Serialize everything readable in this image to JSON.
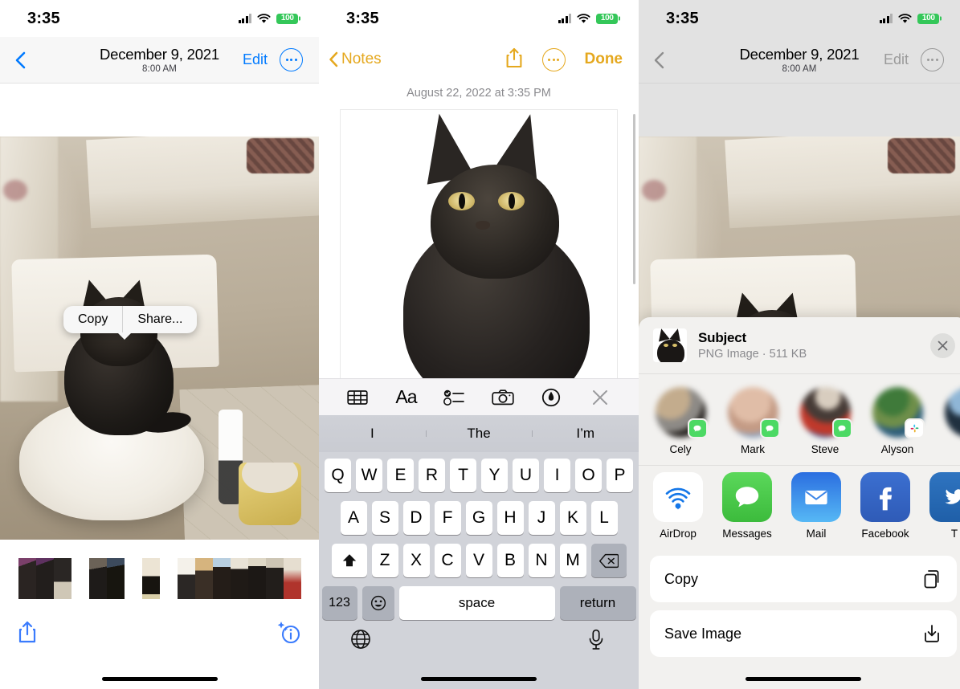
{
  "status_bar": {
    "time": "3:35",
    "battery": "100",
    "wifi_icon": "wifi-icon",
    "cellular_icon": "cellular-icon"
  },
  "panel_photos": {
    "nav": {
      "back_icon": "chevron-left-icon",
      "title": "December 9, 2021",
      "subtitle": "8:00 AM",
      "edit_label": "Edit",
      "more_icon": "ellipsis-circle-icon"
    },
    "context_menu": {
      "copy_label": "Copy",
      "share_label": "Share..."
    },
    "toolbar": {
      "share_icon": "share-icon",
      "info_icon": "info-sparkle-icon"
    }
  },
  "panel_notes": {
    "nav": {
      "back_icon": "chevron-left-icon",
      "back_label": "Notes",
      "share_icon": "share-icon",
      "more_icon": "ellipsis-circle-icon",
      "done_label": "Done",
      "accent_color": "#e5a81e"
    },
    "date_stamp": "August 22, 2022 at 3:35 PM",
    "toolbar": [
      {
        "name": "table-icon",
        "label": ""
      },
      {
        "name": "text-format-icon",
        "label": "Aa"
      },
      {
        "name": "checklist-icon",
        "label": ""
      },
      {
        "name": "camera-icon",
        "label": ""
      },
      {
        "name": "markup-pen-icon",
        "label": ""
      },
      {
        "name": "close-icon",
        "label": ""
      }
    ],
    "keyboard": {
      "suggestions": [
        "I",
        "The",
        "I’m"
      ],
      "row1": [
        "Q",
        "W",
        "E",
        "R",
        "T",
        "Y",
        "U",
        "I",
        "O",
        "P"
      ],
      "row2": [
        "A",
        "S",
        "D",
        "F",
        "G",
        "H",
        "J",
        "K",
        "L"
      ],
      "row3": [
        "Z",
        "X",
        "C",
        "V",
        "B",
        "N",
        "M"
      ],
      "shift_icon": "shift-icon",
      "backspace_icon": "backspace-icon",
      "numbers_label": "123",
      "emoji_icon": "emoji-icon",
      "space_label": "space",
      "return_label": "return",
      "globe_icon": "globe-icon",
      "dictation_icon": "microphone-icon"
    }
  },
  "panel_share": {
    "nav": {
      "back_icon": "chevron-left-icon",
      "title": "December 9, 2021",
      "subtitle": "8:00 AM",
      "edit_label": "Edit",
      "more_icon": "ellipsis-circle-icon"
    },
    "preview": {
      "title": "Subject",
      "meta": "PNG Image · 511 KB",
      "close_icon": "close-circle-icon",
      "thumbnail_icon": "cat-cutout-thumbnail"
    },
    "contacts": [
      {
        "name": "Cely",
        "badge": "messages-badge-icon",
        "avatar_colors": [
          "#b9a489",
          "#7a8a9c",
          "#2d2a28"
        ]
      },
      {
        "name": "Mark",
        "badge": "messages-badge-icon",
        "avatar_colors": [
          "#d8b6a4",
          "#c89b86",
          "#8fa3bd"
        ]
      },
      {
        "name": "Steve",
        "badge": "messages-badge-icon",
        "avatar_colors": [
          "#4a3f3c",
          "#c0392b",
          "#3b5a9a"
        ]
      },
      {
        "name": "Alyson",
        "badge": "slack-badge-icon",
        "avatar_colors": [
          "#3f7a3a",
          "#2f5f7a",
          "#6f8f4a"
        ]
      },
      {
        "name": "",
        "badge": "",
        "avatar_colors": [
          "#1d2a3a",
          "#6f8fb0",
          "#101418"
        ]
      }
    ],
    "apps": [
      {
        "name": "AirDrop",
        "icon": "airdrop-icon"
      },
      {
        "name": "Messages",
        "icon": "messages-icon"
      },
      {
        "name": "Mail",
        "icon": "mail-icon"
      },
      {
        "name": "Facebook",
        "icon": "facebook-icon"
      },
      {
        "name": "T",
        "icon": "twitter-icon"
      }
    ],
    "actions": [
      {
        "label": "Copy",
        "icon": "copy-icon"
      },
      {
        "label": "Save Image",
        "icon": "save-image-icon"
      }
    ]
  },
  "colors": {
    "ios_blue": "#007aff",
    "notes_yellow": "#e5a81e",
    "battery_green": "#34c759",
    "messages_green": "#4cd964"
  }
}
